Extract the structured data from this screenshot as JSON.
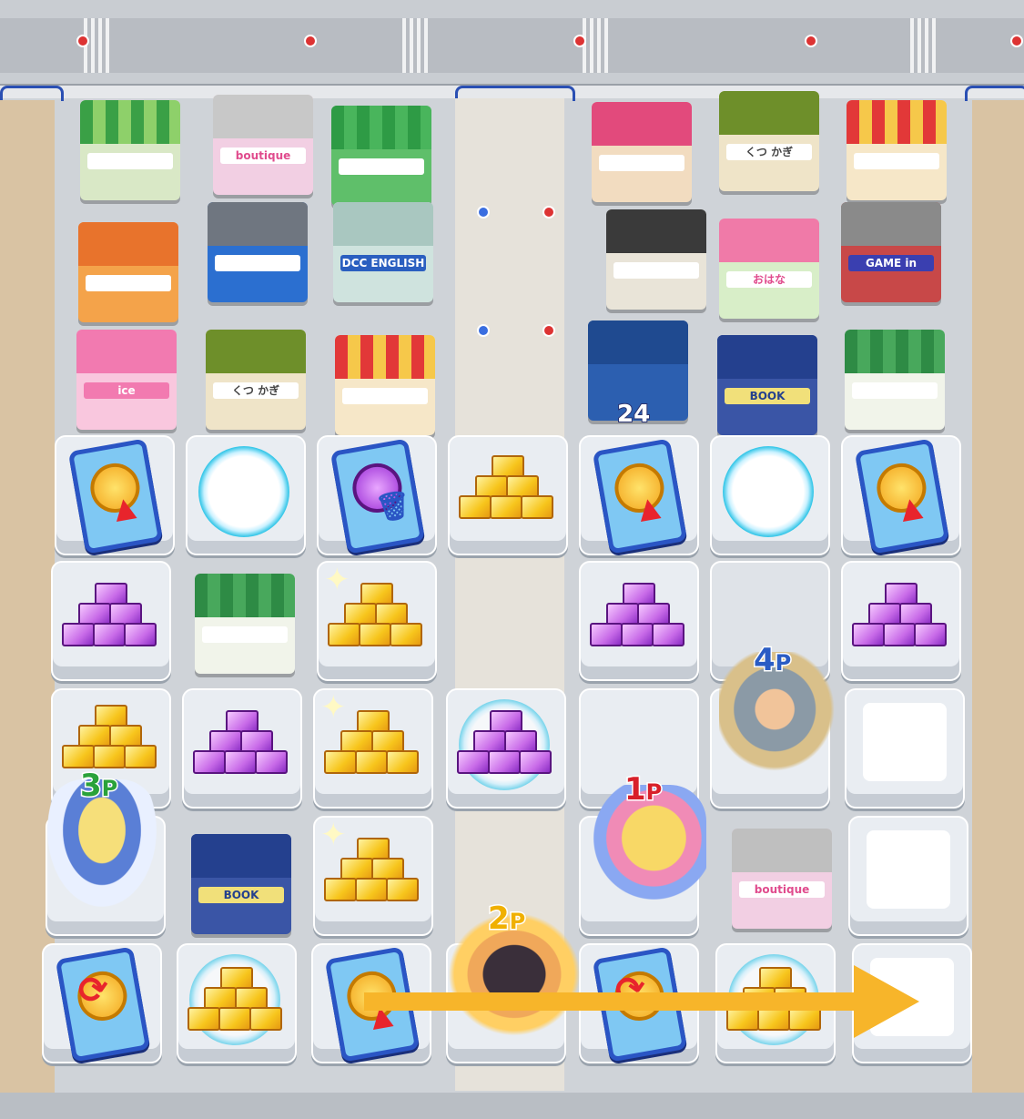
{
  "board": {
    "players": {
      "p1": {
        "label": "1",
        "suffix": "P",
        "color": "#d8202a"
      },
      "p2": {
        "label": "2",
        "suffix": "P",
        "color": "#f0b000"
      },
      "p3": {
        "label": "3",
        "suffix": "P",
        "color": "#2aa23a"
      },
      "p4": {
        "label": "4",
        "suffix": "P",
        "color": "#2a5cc4"
      }
    },
    "move_arrow": {
      "direction": "right",
      "color": "#f7b52a"
    },
    "building_number": "24"
  },
  "buildings": [
    {
      "id": "b1",
      "sign": "",
      "roof": "#3aa046"
    },
    {
      "id": "b2",
      "sign": "boutique",
      "roof": "#c8c8c8"
    },
    {
      "id": "b3",
      "sign": "",
      "roof": "#2e9b45"
    },
    {
      "id": "b4",
      "sign": "",
      "roof": "#e24a7c"
    },
    {
      "id": "b5",
      "sign": "くつ かぎ",
      "roof": "#6e8f2a"
    },
    {
      "id": "b6",
      "sign": "",
      "roof": "#e23838"
    },
    {
      "id": "b7",
      "sign": "",
      "roof": "#e8732c"
    },
    {
      "id": "b8",
      "sign": "",
      "roof": "#6f7680"
    },
    {
      "id": "b9",
      "sign": "DCC ENGLISH",
      "roof": "#a9c7c0"
    },
    {
      "id": "b10",
      "sign": "",
      "roof": "#3a3a3a"
    },
    {
      "id": "b11",
      "sign": "おはな",
      "roof": "#f07aa8"
    },
    {
      "id": "b12",
      "sign": "GAME in",
      "roof": "#8a8a8a"
    },
    {
      "id": "b13",
      "sign": "ice",
      "roof": "#f27ab0"
    },
    {
      "id": "b14",
      "sign": "くつ かぎ",
      "roof": "#6e8f2a"
    },
    {
      "id": "b15",
      "sign": "",
      "roof": "#e23838"
    },
    {
      "id": "b16",
      "sign": "",
      "roof": "#2c5fb0"
    },
    {
      "id": "b17",
      "sign": "BOOK",
      "roof": "#24408e"
    },
    {
      "id": "b18",
      "sign": "",
      "roof": "#2e8b45"
    },
    {
      "id": "b19",
      "sign": "",
      "roof": "#2e8b45"
    },
    {
      "id": "b20",
      "sign": "BOOK",
      "roof": "#24408e"
    },
    {
      "id": "b21",
      "sign": "boutique",
      "roof": "#bfbfbf"
    }
  ],
  "tiles": {
    "row1": [
      "card-gold-up",
      "portal",
      "card-purple-trash",
      "gold",
      "card-gold-up",
      "portal",
      "card-gold-up"
    ],
    "row2": [
      "purple",
      "building",
      "gold",
      "road",
      "purple",
      "building-player",
      "purple"
    ],
    "row3": [
      "gold",
      "purple",
      "gold",
      "purple",
      "empty-player",
      "empty-player",
      "empty"
    ],
    "row4": [
      "player",
      "building",
      "gold",
      "road",
      "player",
      "building",
      "empty"
    ],
    "row5": [
      "card-swap",
      "gold",
      "card-gold-up",
      "player",
      "card-swap",
      "gold",
      "empty"
    ]
  }
}
